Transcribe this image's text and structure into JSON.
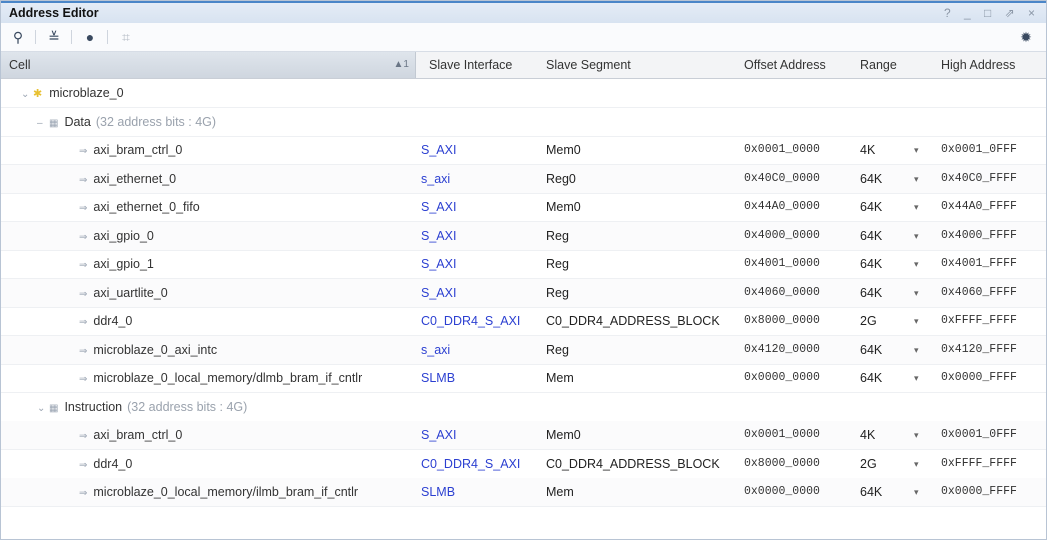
{
  "window": {
    "title": "Address Editor",
    "controls": "? _ □ ⇗ ×"
  },
  "toolbar": {
    "search_icon": "⚲",
    "collapse_icon": "≚",
    "expand_icon": "●",
    "tree_icon": "⌗",
    "settings_icon": "✹"
  },
  "columns": {
    "cell": "Cell",
    "slave_interface": "Slave Interface",
    "slave_segment": "Slave Segment",
    "offset_address": "Offset Address",
    "range": "Range",
    "high_address": "High Address"
  },
  "root": "microblaze_0",
  "groups": [
    {
      "name": "Data",
      "meta": "(32 address bits : 4G)",
      "rows": [
        {
          "cell": "axi_bram_ctrl_0",
          "iface": "S_AXI",
          "segment": "Mem0",
          "offset": "0x0001_0000",
          "range": "4K",
          "high": "0x0001_0FFF"
        },
        {
          "cell": "axi_ethernet_0",
          "iface": "s_axi",
          "segment": "Reg0",
          "offset": "0x40C0_0000",
          "range": "64K",
          "high": "0x40C0_FFFF"
        },
        {
          "cell": "axi_ethernet_0_fifo",
          "iface": "S_AXI",
          "segment": "Mem0",
          "offset": "0x44A0_0000",
          "range": "64K",
          "high": "0x44A0_FFFF"
        },
        {
          "cell": "axi_gpio_0",
          "iface": "S_AXI",
          "segment": "Reg",
          "offset": "0x4000_0000",
          "range": "64K",
          "high": "0x4000_FFFF"
        },
        {
          "cell": "axi_gpio_1",
          "iface": "S_AXI",
          "segment": "Reg",
          "offset": "0x4001_0000",
          "range": "64K",
          "high": "0x4001_FFFF"
        },
        {
          "cell": "axi_uartlite_0",
          "iface": "S_AXI",
          "segment": "Reg",
          "offset": "0x4060_0000",
          "range": "64K",
          "high": "0x4060_FFFF"
        },
        {
          "cell": "ddr4_0",
          "iface": "C0_DDR4_S_AXI",
          "segment": "C0_DDR4_ADDRESS_BLOCK",
          "offset": "0x8000_0000",
          "range": "2G",
          "high": "0xFFFF_FFFF"
        },
        {
          "cell": "microblaze_0_axi_intc",
          "iface": "s_axi",
          "segment": "Reg",
          "offset": "0x4120_0000",
          "range": "64K",
          "high": "0x4120_FFFF"
        },
        {
          "cell": "microblaze_0_local_memory/dlmb_bram_if_cntlr",
          "iface": "SLMB",
          "segment": "Mem",
          "offset": "0x0000_0000",
          "range": "64K",
          "high": "0x0000_FFFF"
        }
      ]
    },
    {
      "name": "Instruction",
      "meta": "(32 address bits : 4G)",
      "rows": [
        {
          "cell": "axi_bram_ctrl_0",
          "iface": "S_AXI",
          "segment": "Mem0",
          "offset": "0x0001_0000",
          "range": "4K",
          "high": "0x0001_0FFF"
        },
        {
          "cell": "ddr4_0",
          "iface": "C0_DDR4_S_AXI",
          "segment": "C0_DDR4_ADDRESS_BLOCK",
          "offset": "0x8000_0000",
          "range": "2G",
          "high": "0xFFFF_FFFF"
        },
        {
          "cell": "microblaze_0_local_memory/ilmb_bram_if_cntlr",
          "iface": "SLMB",
          "segment": "Mem",
          "offset": "0x0000_0000",
          "range": "64K",
          "high": "0x0000_FFFF"
        }
      ]
    }
  ]
}
